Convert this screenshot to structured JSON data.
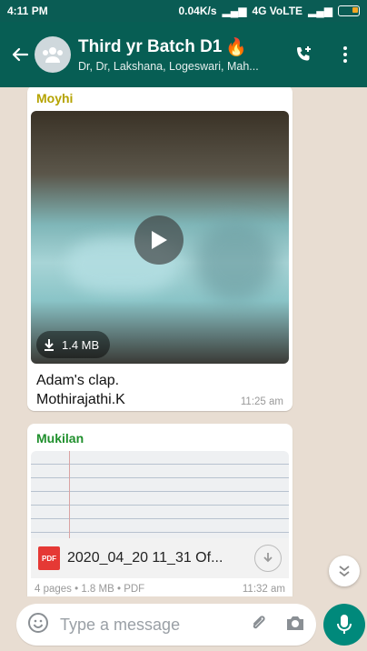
{
  "status_bar": {
    "time": "4:11 PM",
    "indicators": "0.04K/s",
    "network": "4G VoLTE"
  },
  "header": {
    "title": "Third yr Batch D1",
    "title_emoji": "🔥",
    "subtitle": "Dr, Dr, Lakshana, Logeswari, Mah..."
  },
  "messages": [
    {
      "sender": "Moyhi",
      "sender_color": "#b5a300",
      "video_size": "1.4 MB",
      "caption_line1": "Adam's clap.",
      "caption_line2": "Mothirajathi.K",
      "time": "11:25 am"
    },
    {
      "sender": "Mukilan",
      "sender_color": "#1f8f2c",
      "doc_type_badge": "PDF",
      "file_name": "2020_04_20 11_31 Of...",
      "meta": "4 pages • 1.8 MB • PDF",
      "time": "11:32 am"
    }
  ],
  "composer": {
    "placeholder": "Type a message"
  },
  "colors": {
    "header_bg": "#075e54",
    "accent": "#00897b"
  }
}
